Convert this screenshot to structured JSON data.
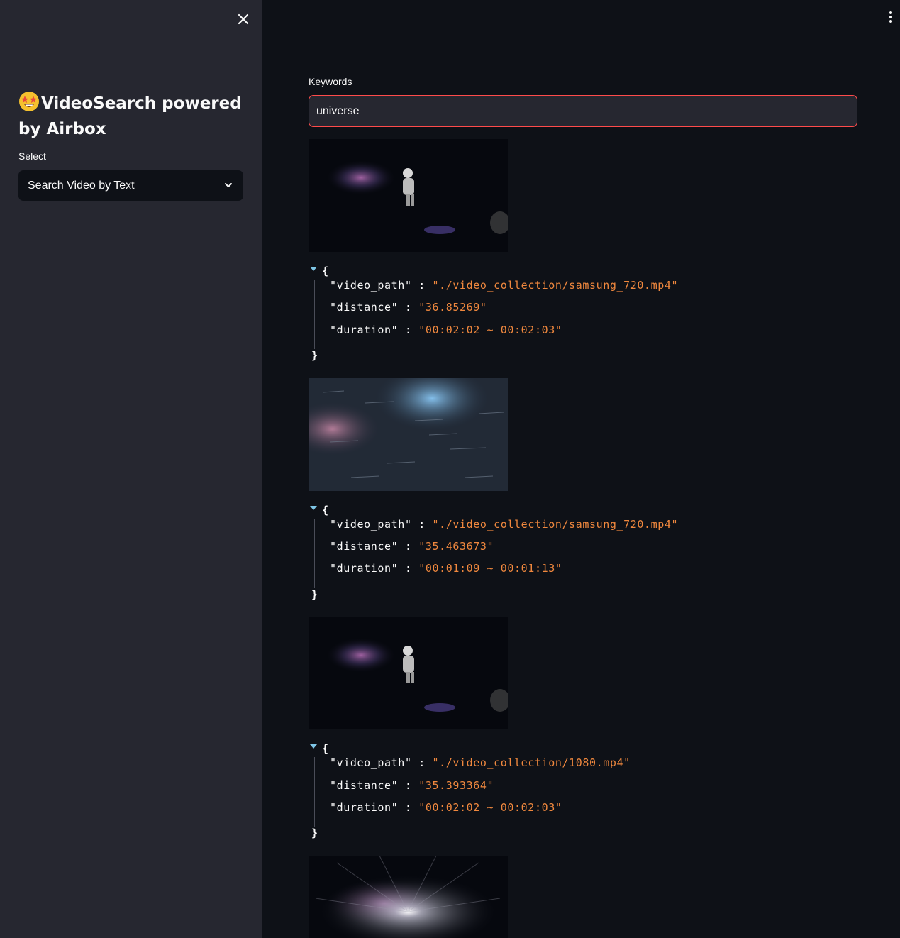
{
  "sidebar": {
    "title_emoji": "star-struck-emoji",
    "title": "VideoSearch powered by Airbox",
    "select_label": "Select",
    "select_value": "Search Video by Text"
  },
  "main": {
    "keywords_label": "Keywords",
    "keywords_value": "universe",
    "results": [
      {
        "thumbnail": "astronaut-in-space",
        "video_path_key": "\"video_path\"",
        "video_path": "\"./video_collection/samsung_720.mp4\"",
        "distance_key": "\"distance\"",
        "distance": "\"36.85269\"",
        "duration_key": "\"duration\"",
        "duration": "\"00:02:02 ~ 00:02:03\""
      },
      {
        "thumbnail": "space-nebula-streaks",
        "video_path_key": "\"video_path\"",
        "video_path": "\"./video_collection/samsung_720.mp4\"",
        "distance_key": "\"distance\"",
        "distance": "\"35.463673\"",
        "duration_key": "\"duration\"",
        "duration": "\"00:01:09 ~ 00:01:13\""
      },
      {
        "thumbnail": "astronaut-in-space",
        "video_path_key": "\"video_path\"",
        "video_path": "\"./video_collection/1080.mp4\"",
        "distance_key": "\"distance\"",
        "distance": "\"35.393364\"",
        "duration_key": "\"duration\"",
        "duration": "\"00:02:02 ~ 00:02:03\""
      }
    ],
    "partial_thumbnail": "star-burst"
  },
  "icons": {
    "close": "close-icon",
    "chevron": "chevron-down-icon",
    "menu": "kebab-menu-icon"
  },
  "colors": {
    "accent": "#ff4b4b",
    "json_value": "#f0883e",
    "sidebar_bg": "#262730",
    "main_bg": "#0e1117"
  }
}
